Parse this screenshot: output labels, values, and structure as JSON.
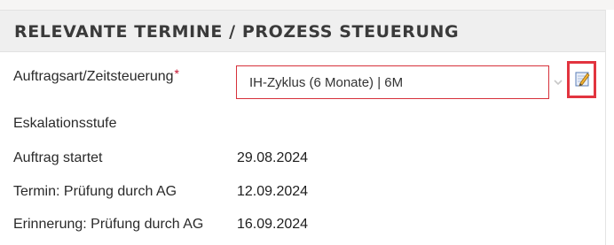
{
  "section": {
    "title": "RELEVANTE TERMINE / PROZESS STEUERUNG"
  },
  "fields": {
    "auftragsart": {
      "label": "Auftragsart/Zeitsteuerung",
      "required_mark": "*",
      "selected_value": "IH-Zyklus (6 Monate) | 6M"
    },
    "eskalationsstufe": {
      "label": "Eskalationsstufe",
      "value": ""
    },
    "auftrag_startet": {
      "label": "Auftrag startet",
      "value": "29.08.2024"
    },
    "termin_pruefung": {
      "label": "Termin: Prüfung durch AG",
      "value": "12.09.2024"
    },
    "erinnerung_pruefung": {
      "label": "Erinnerung: Prüfung durch AG",
      "value": "16.09.2024"
    }
  },
  "icons": {
    "dropdown": "chevron-down-icon",
    "edit": "edit-pencil-icon"
  },
  "colors": {
    "required": "#c4122f",
    "invalid_border": "#d6313a",
    "highlight": "#e2343f",
    "header_bg": "#efefef"
  }
}
